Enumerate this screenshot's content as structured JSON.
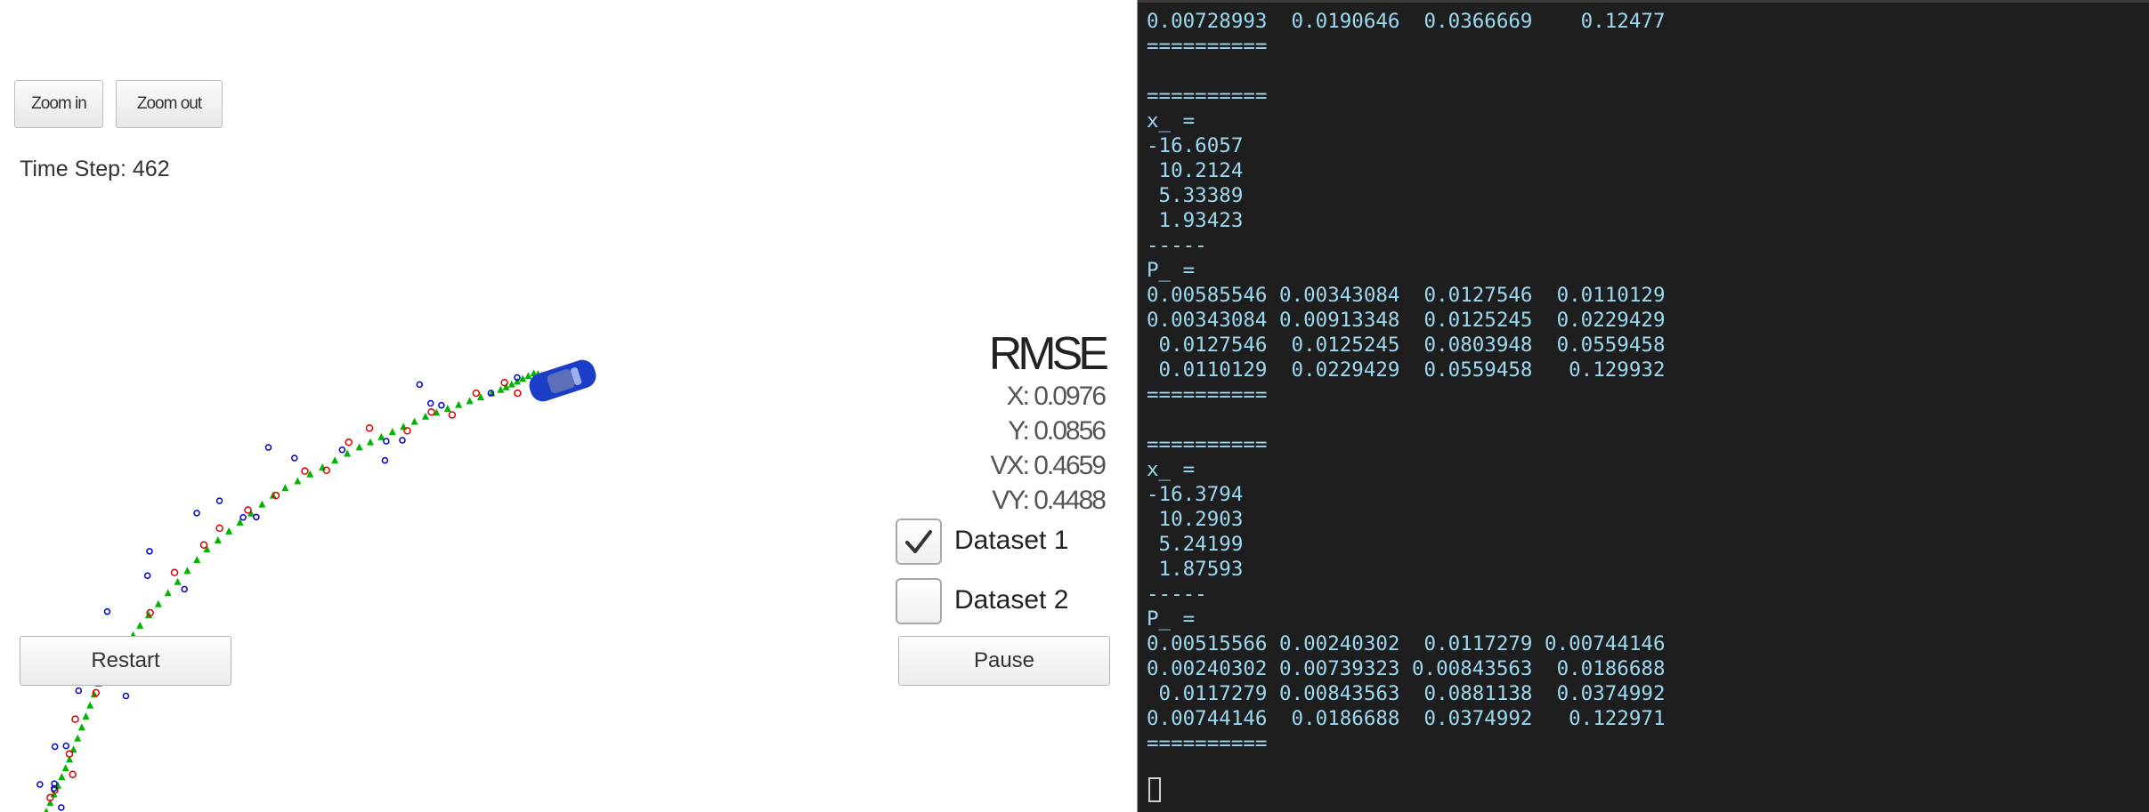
{
  "simulator": {
    "zoom_in_label": "Zoom in",
    "zoom_out_label": "Zoom out",
    "time_step_text": "Time Step: 462",
    "restart_label": "Restart",
    "pause_label": "Pause",
    "rmse": {
      "title": "RMSE",
      "x": "X: 0.0976",
      "y": "Y: 0.0856",
      "vx": "VX: 0.4659",
      "vy": "VY: 0.4488"
    },
    "datasets": [
      {
        "label": "Dataset 1",
        "checked": true
      },
      {
        "label": "Dataset 2",
        "checked": false
      }
    ],
    "colors": {
      "estimate_marker": "#00b400",
      "radar_marker": "#e00000",
      "lidar_marker": "#0000cc",
      "car_body": "#1a3ec8"
    },
    "car_icon": "car-icon"
  },
  "terminal": {
    "lines": [
      "0.00728993  0.0190646  0.0366669    0.12477",
      "==========",
      "",
      "==========",
      "x_ =",
      "-16.6057",
      " 10.2124",
      " 5.33389",
      " 1.93423",
      "-----",
      "P_ =",
      "0.00585546 0.00343084  0.0127546  0.0110129",
      "0.00343084 0.00913348  0.0125245  0.0229429",
      " 0.0127546  0.0125245  0.0803948  0.0559458",
      " 0.0110129  0.0229429  0.0559458   0.129932",
      "==========",
      "",
      "==========",
      "x_ =",
      "-16.3794",
      " 10.2903",
      " 5.24199",
      " 1.87593",
      "-----",
      "P_ =",
      "0.00515566 0.00240302  0.0117279 0.00744146",
      "0.00240302 0.00739323 0.00843563  0.0186688",
      " 0.0117279 0.00843563  0.0881138  0.0374992",
      "0.00744146  0.0186688  0.0374992   0.122971",
      "=========="
    ]
  }
}
